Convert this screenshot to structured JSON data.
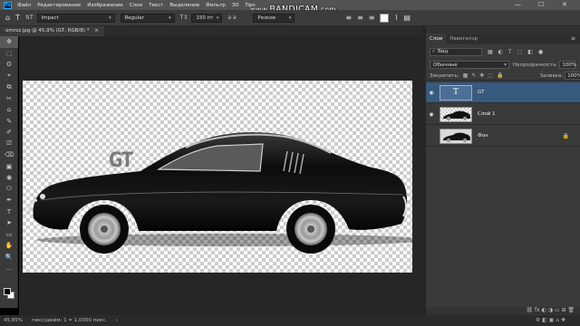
{
  "app": {
    "logo": "Ps"
  },
  "menu": [
    "Файл",
    "Редактирование",
    "Изображение",
    "Слои",
    "Текст",
    "Выделение",
    "Фильтр",
    "3D",
    "Про"
  ],
  "watermark": {
    "prefix": "www.",
    "brand": "BANDICAM",
    "suffix": ".com"
  },
  "window_controls": {
    "minimize": "—",
    "maximize": "☐",
    "close": "✕"
  },
  "options": {
    "tool_icon": "T",
    "orient_icon": "⇅T",
    "font_family": "Impact",
    "font_style": "Regular",
    "size_icon": "T↕",
    "font_size": "150 пт",
    "aa_label": "a a",
    "antialias": "Резкое"
  },
  "document": {
    "tab_label": "omroz.jpg @ 45,9% (GT, RGB/8) *",
    "close_glyph": "×",
    "canvas_text": "GT"
  },
  "tools": [
    "✥",
    "⬚",
    "ʘ",
    "⌖",
    "⧉",
    "✂",
    "⌂",
    "✎",
    "✐",
    "⎚",
    "⌫",
    "▣",
    "◉",
    "⬭",
    "✒",
    "T",
    "➤",
    "▭",
    "✋",
    "🔍",
    "…"
  ],
  "status": {
    "zoom": "45,85%",
    "info": "пикс/дюйм: 1 = 1,0000 пикс.",
    "arrow": "›",
    "icons": "⚙ ◧ ▣ ⌂ ✚"
  },
  "panel": {
    "tabs": [
      "Слои",
      "Навигатор"
    ],
    "menu_icon": "≡",
    "filter_icon": "⌕",
    "filter_value": "Вид",
    "filter_icons": [
      "▦",
      "◐",
      "T",
      "⬚",
      "◧",
      "●"
    ],
    "blend_mode": "Обычные",
    "opacity_label": "Непрозрачность:",
    "opacity": "100%",
    "lock_label": "Закрепить:",
    "lock_icons": [
      "▦",
      "✎",
      "✥",
      "⬚",
      "🔒"
    ],
    "fill_label": "Заливка:",
    "fill": "100%",
    "layers": [
      {
        "name": "GT",
        "type": "text",
        "glyph": "T",
        "selected": true,
        "visible": true
      },
      {
        "name": "Слой 1",
        "type": "car",
        "selected": false,
        "visible": true
      },
      {
        "name": "Фон",
        "type": "photo",
        "selected": false,
        "visible": false,
        "locked": true
      }
    ],
    "bottom_icons": "⛓ fx ◐ ◑ ▭ ⊞ 🗑"
  }
}
